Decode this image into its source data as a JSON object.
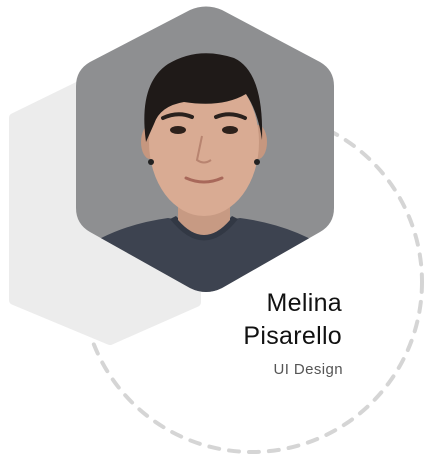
{
  "profile": {
    "first_name": "Melina",
    "last_name": "Pisarello",
    "role": "UI Design"
  },
  "colors": {
    "background": "#ffffff",
    "back_hexagon": "#ececec",
    "photo_backdrop": "#8e8f91",
    "dashed_circle": "#d5d5d5",
    "name_text": "#111111",
    "role_text": "#555555"
  }
}
